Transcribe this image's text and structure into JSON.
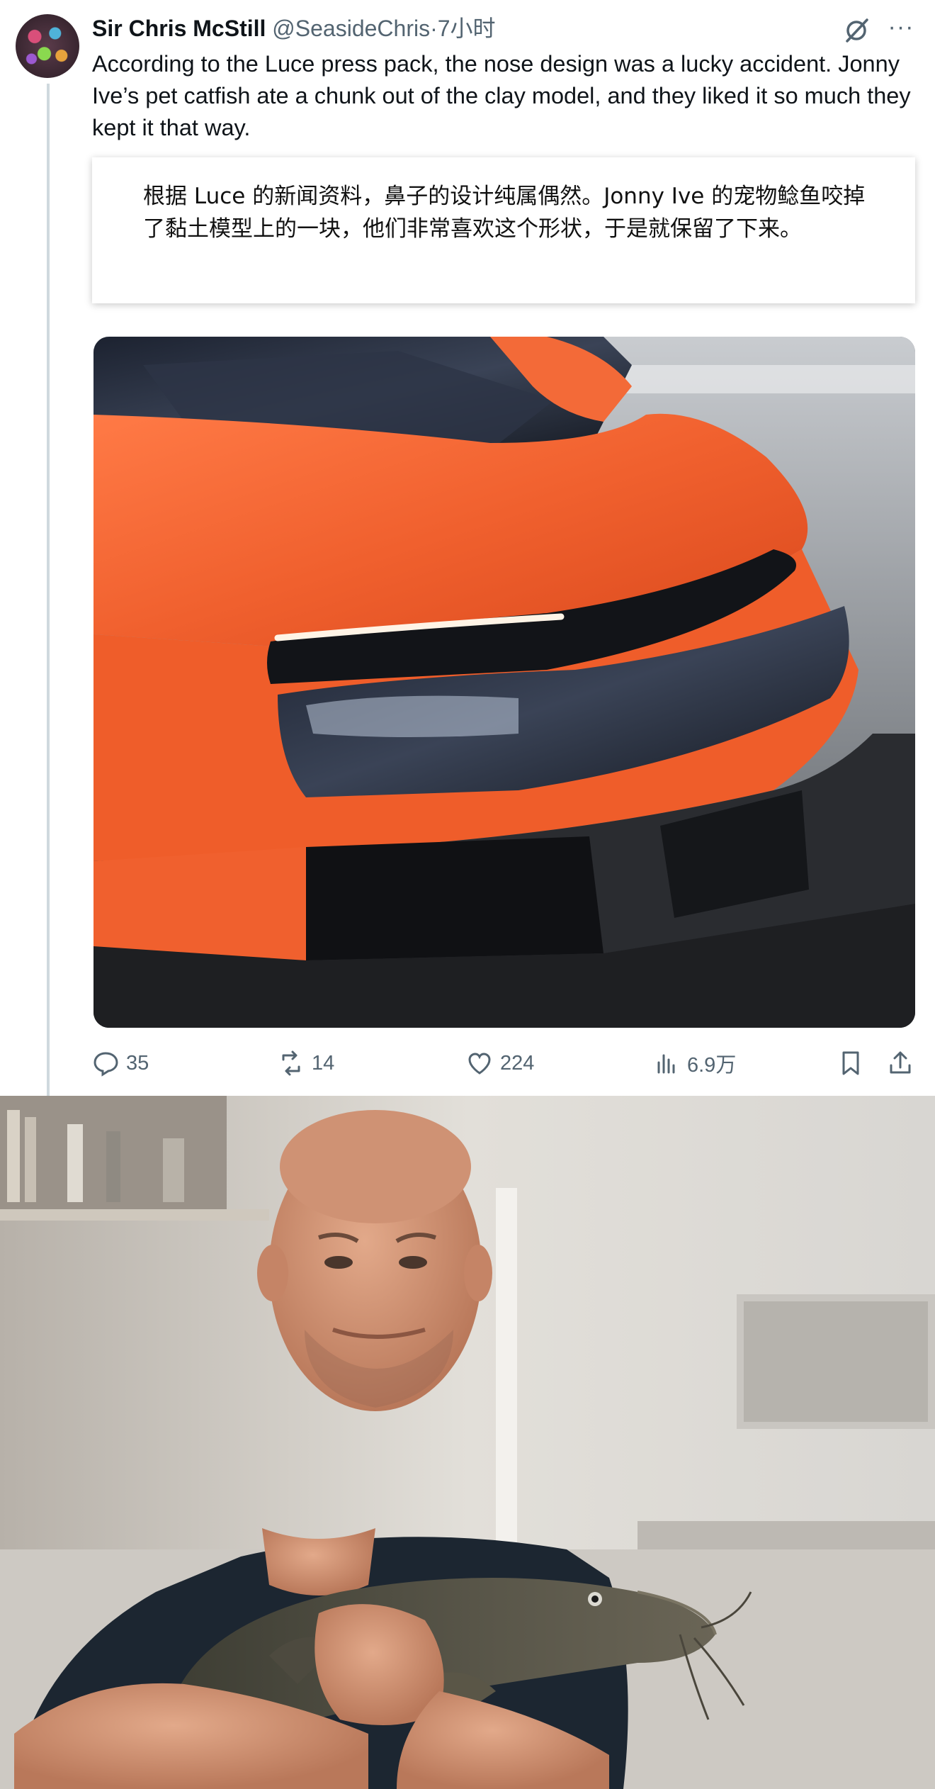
{
  "tweet": {
    "author_name": "Sir Chris McStill",
    "handle": "@SeasideChris",
    "separator": "·",
    "time": "7小时",
    "text": "According to the Luce press pack, the nose design was a lucky accident. Jonny Ive’s pet catfish ate a chunk out of the clay model, and they liked it so much they kept it that  way.",
    "translation": "根据 Luce 的新闻资料，鼻子的设计纯属偶然。Jonny Ive 的宠物鲶鱼咬掉了黏土模型上的一块，他们非常喜欢这个形状，于是就保留了下来。",
    "more_glyph": "···"
  },
  "actions": {
    "replies": "35",
    "reposts": "14",
    "likes": "224",
    "views": "6.9万"
  },
  "icons": [
    "grok-icon",
    "more-icon",
    "reply-icon",
    "repost-icon",
    "like-icon",
    "views-icon",
    "bookmark-icon",
    "share-icon"
  ],
  "colors": {
    "text": "#0f1419",
    "muted": "#536471",
    "car_orange": "#f0602e",
    "thread_line": "#cfd9de"
  }
}
